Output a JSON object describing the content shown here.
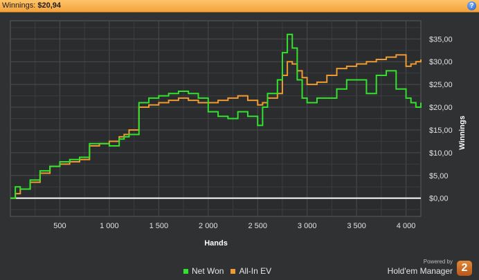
{
  "header": {
    "label": "Winnings:",
    "value": "$20,94",
    "help_glyph": "?"
  },
  "chart_data": {
    "type": "line",
    "xlabel": "Hands",
    "ylabel": "Winnings",
    "xlim": [
      0,
      4150
    ],
    "ylim": [
      -4,
      39
    ],
    "x_ticks": [
      500,
      1000,
      1500,
      2000,
      2500,
      3000,
      3500,
      4000
    ],
    "x_tick_labels": [
      "500",
      "1 000",
      "1 500",
      "2 000",
      "2 500",
      "3 000",
      "3 500",
      "4 000"
    ],
    "y_ticks": [
      0,
      5,
      10,
      15,
      20,
      25,
      30,
      35
    ],
    "y_tick_labels": [
      "$0,00",
      "$5,00",
      "$10,00",
      "$15,00",
      "$20,00",
      "$25,00",
      "$30,00",
      "$35,00"
    ],
    "grid": true,
    "legend_position": "bottom",
    "series": [
      {
        "name": "Net Won",
        "color": "#33e22c",
        "x": [
          0,
          50,
          100,
          200,
          300,
          400,
          500,
          600,
          700,
          800,
          900,
          1000,
          1100,
          1150,
          1200,
          1300,
          1400,
          1500,
          1600,
          1700,
          1800,
          1900,
          2000,
          2100,
          2200,
          2300,
          2400,
          2500,
          2550,
          2600,
          2700,
          2750,
          2800,
          2850,
          2900,
          2950,
          3000,
          3100,
          3200,
          3300,
          3400,
          3500,
          3600,
          3700,
          3800,
          3900,
          4000,
          4050,
          4100,
          4150
        ],
        "y": [
          0,
          2.5,
          2,
          4,
          6,
          7,
          8,
          8.5,
          9,
          12,
          12,
          11.5,
          13,
          13.5,
          14,
          21,
          22,
          22.5,
          23,
          23.5,
          23,
          22,
          19,
          18,
          17.5,
          19,
          18,
          16,
          20,
          23,
          26,
          32,
          36,
          33,
          26,
          22,
          21,
          22,
          22,
          24,
          26,
          26,
          23,
          27,
          28,
          24,
          22,
          21,
          20,
          21
        ]
      },
      {
        "name": "All-In EV",
        "color": "#f09a32",
        "x": [
          0,
          50,
          100,
          200,
          300,
          400,
          500,
          600,
          700,
          800,
          900,
          1000,
          1100,
          1150,
          1200,
          1300,
          1400,
          1500,
          1600,
          1700,
          1800,
          1900,
          2000,
          2100,
          2200,
          2300,
          2400,
          2500,
          2550,
          2600,
          2700,
          2750,
          2800,
          2850,
          2900,
          2950,
          3000,
          3100,
          3200,
          3300,
          3400,
          3500,
          3600,
          3700,
          3800,
          3900,
          4000,
          4050,
          4100,
          4150
        ],
        "y": [
          0,
          1,
          2,
          3.5,
          5.5,
          7,
          7.5,
          8,
          8.5,
          11.5,
          12,
          12.5,
          13.5,
          14,
          15,
          20,
          20.5,
          21,
          21.5,
          22,
          21.5,
          21,
          21,
          21.5,
          22,
          22.5,
          21.5,
          20.5,
          21,
          22,
          23,
          27,
          30,
          29.5,
          28,
          26.5,
          25,
          25.5,
          27,
          28.5,
          29,
          29.5,
          30,
          30.5,
          31,
          31.5,
          29,
          29.5,
          30,
          30.5
        ]
      }
    ]
  },
  "branding": {
    "powered_by": "Powered by",
    "name": "Hold'em Manager",
    "logo_glyph": "2"
  }
}
